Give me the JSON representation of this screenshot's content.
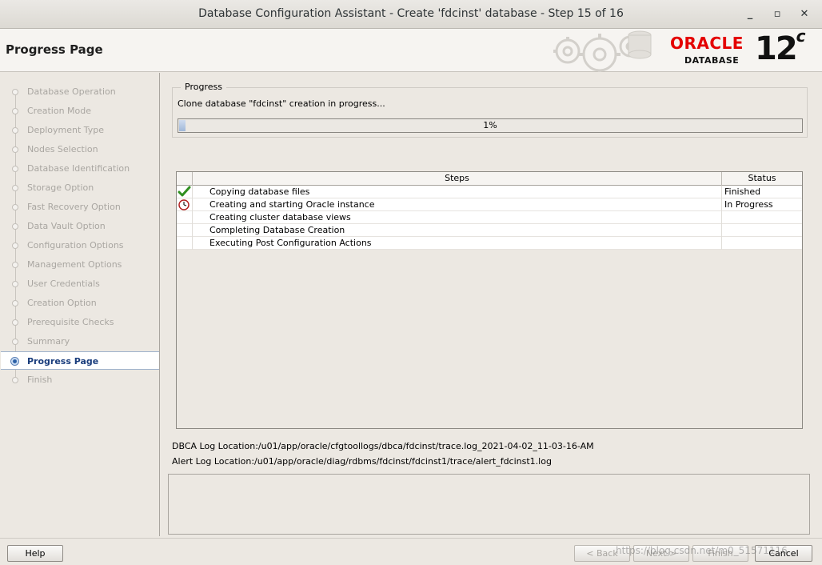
{
  "window": {
    "title": "Database Configuration Assistant - Create 'fdcinst' database - Step 15 of 16",
    "minimize": "_",
    "maximize": "▫",
    "close": "✕"
  },
  "header": {
    "page_title": "Progress Page",
    "logo_text": "ORACLE",
    "logo_sub": "DATABASE",
    "version": "12",
    "version_suffix": "c",
    "colors": {
      "oracle_red": "#e40000"
    }
  },
  "sidebar": {
    "items": [
      {
        "label": "Database Operation",
        "state": "done"
      },
      {
        "label": "Creation Mode",
        "state": "done"
      },
      {
        "label": "Deployment Type",
        "state": "done"
      },
      {
        "label": "Nodes Selection",
        "state": "done"
      },
      {
        "label": "Database Identification",
        "state": "done"
      },
      {
        "label": "Storage Option",
        "state": "done"
      },
      {
        "label": "Fast Recovery Option",
        "state": "done"
      },
      {
        "label": "Data Vault Option",
        "state": "done"
      },
      {
        "label": "Configuration Options",
        "state": "done"
      },
      {
        "label": "Management Options",
        "state": "done"
      },
      {
        "label": "User Credentials",
        "state": "done"
      },
      {
        "label": "Creation Option",
        "state": "done"
      },
      {
        "label": "Prerequisite Checks",
        "state": "done"
      },
      {
        "label": "Summary",
        "state": "done"
      },
      {
        "label": "Progress Page",
        "state": "active"
      },
      {
        "label": "Finish",
        "state": "pending"
      }
    ]
  },
  "progress": {
    "legend": "Progress",
    "status_text": "Clone database \"fdcinst\" creation in progress...",
    "percent_label": "1%",
    "fraction": 0.01
  },
  "steps_table": {
    "columns": [
      "Steps",
      "Status"
    ],
    "rows": [
      {
        "icon": "check-icon",
        "step": "Copying database files",
        "status": "Finished"
      },
      {
        "icon": "clock-icon",
        "step": "Creating and starting Oracle instance",
        "status": "In Progress"
      },
      {
        "icon": "",
        "step": "Creating cluster database views",
        "status": ""
      },
      {
        "icon": "",
        "step": "Completing Database Creation",
        "status": ""
      },
      {
        "icon": "",
        "step": "Executing Post Configuration Actions",
        "status": ""
      }
    ]
  },
  "logs": {
    "dbca": "DBCA Log Location:/u01/app/oracle/cfgtoollogs/dbca/fdcinst/trace.log_2021-04-02_11-03-16-AM",
    "alert": "Alert Log Location:/u01/app/oracle/diag/rdbms/fdcinst/fdcinst1/trace/alert_fdcinst1.log"
  },
  "footer": {
    "help": "Help",
    "back": "< Back",
    "next": "Next >",
    "finish": "Finish",
    "cancel": "Cancel"
  },
  "watermark": "https://blog.csdn.net/m0_51571116"
}
